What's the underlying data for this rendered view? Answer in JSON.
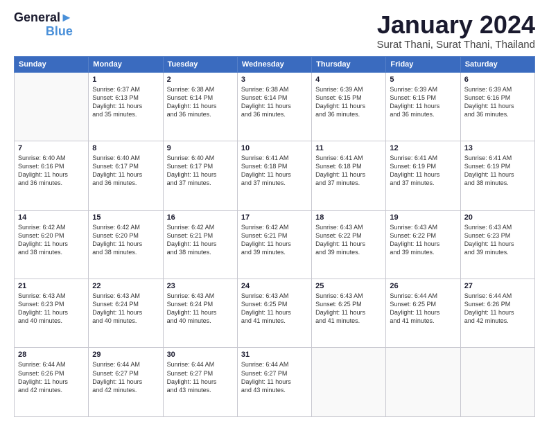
{
  "logo": {
    "line1": "General",
    "line2": "Blue"
  },
  "title": "January 2024",
  "subtitle": "Surat Thani, Surat Thani, Thailand",
  "header_days": [
    "Sunday",
    "Monday",
    "Tuesday",
    "Wednesday",
    "Thursday",
    "Friday",
    "Saturday"
  ],
  "weeks": [
    [
      {
        "day": "",
        "sunrise": "",
        "sunset": "",
        "daylight": ""
      },
      {
        "day": "1",
        "sunrise": "Sunrise: 6:37 AM",
        "sunset": "Sunset: 6:13 PM",
        "daylight": "Daylight: 11 hours and 35 minutes."
      },
      {
        "day": "2",
        "sunrise": "Sunrise: 6:38 AM",
        "sunset": "Sunset: 6:14 PM",
        "daylight": "Daylight: 11 hours and 36 minutes."
      },
      {
        "day": "3",
        "sunrise": "Sunrise: 6:38 AM",
        "sunset": "Sunset: 6:14 PM",
        "daylight": "Daylight: 11 hours and 36 minutes."
      },
      {
        "day": "4",
        "sunrise": "Sunrise: 6:39 AM",
        "sunset": "Sunset: 6:15 PM",
        "daylight": "Daylight: 11 hours and 36 minutes."
      },
      {
        "day": "5",
        "sunrise": "Sunrise: 6:39 AM",
        "sunset": "Sunset: 6:15 PM",
        "daylight": "Daylight: 11 hours and 36 minutes."
      },
      {
        "day": "6",
        "sunrise": "Sunrise: 6:39 AM",
        "sunset": "Sunset: 6:16 PM",
        "daylight": "Daylight: 11 hours and 36 minutes."
      }
    ],
    [
      {
        "day": "7",
        "sunrise": "Sunrise: 6:40 AM",
        "sunset": "Sunset: 6:16 PM",
        "daylight": "Daylight: 11 hours and 36 minutes."
      },
      {
        "day": "8",
        "sunrise": "Sunrise: 6:40 AM",
        "sunset": "Sunset: 6:17 PM",
        "daylight": "Daylight: 11 hours and 36 minutes."
      },
      {
        "day": "9",
        "sunrise": "Sunrise: 6:40 AM",
        "sunset": "Sunset: 6:17 PM",
        "daylight": "Daylight: 11 hours and 37 minutes."
      },
      {
        "day": "10",
        "sunrise": "Sunrise: 6:41 AM",
        "sunset": "Sunset: 6:18 PM",
        "daylight": "Daylight: 11 hours and 37 minutes."
      },
      {
        "day": "11",
        "sunrise": "Sunrise: 6:41 AM",
        "sunset": "Sunset: 6:18 PM",
        "daylight": "Daylight: 11 hours and 37 minutes."
      },
      {
        "day": "12",
        "sunrise": "Sunrise: 6:41 AM",
        "sunset": "Sunset: 6:19 PM",
        "daylight": "Daylight: 11 hours and 37 minutes."
      },
      {
        "day": "13",
        "sunrise": "Sunrise: 6:41 AM",
        "sunset": "Sunset: 6:19 PM",
        "daylight": "Daylight: 11 hours and 38 minutes."
      }
    ],
    [
      {
        "day": "14",
        "sunrise": "Sunrise: 6:42 AM",
        "sunset": "Sunset: 6:20 PM",
        "daylight": "Daylight: 11 hours and 38 minutes."
      },
      {
        "day": "15",
        "sunrise": "Sunrise: 6:42 AM",
        "sunset": "Sunset: 6:20 PM",
        "daylight": "Daylight: 11 hours and 38 minutes."
      },
      {
        "day": "16",
        "sunrise": "Sunrise: 6:42 AM",
        "sunset": "Sunset: 6:21 PM",
        "daylight": "Daylight: 11 hours and 38 minutes."
      },
      {
        "day": "17",
        "sunrise": "Sunrise: 6:42 AM",
        "sunset": "Sunset: 6:21 PM",
        "daylight": "Daylight: 11 hours and 39 minutes."
      },
      {
        "day": "18",
        "sunrise": "Sunrise: 6:43 AM",
        "sunset": "Sunset: 6:22 PM",
        "daylight": "Daylight: 11 hours and 39 minutes."
      },
      {
        "day": "19",
        "sunrise": "Sunrise: 6:43 AM",
        "sunset": "Sunset: 6:22 PM",
        "daylight": "Daylight: 11 hours and 39 minutes."
      },
      {
        "day": "20",
        "sunrise": "Sunrise: 6:43 AM",
        "sunset": "Sunset: 6:23 PM",
        "daylight": "Daylight: 11 hours and 39 minutes."
      }
    ],
    [
      {
        "day": "21",
        "sunrise": "Sunrise: 6:43 AM",
        "sunset": "Sunset: 6:23 PM",
        "daylight": "Daylight: 11 hours and 40 minutes."
      },
      {
        "day": "22",
        "sunrise": "Sunrise: 6:43 AM",
        "sunset": "Sunset: 6:24 PM",
        "daylight": "Daylight: 11 hours and 40 minutes."
      },
      {
        "day": "23",
        "sunrise": "Sunrise: 6:43 AM",
        "sunset": "Sunset: 6:24 PM",
        "daylight": "Daylight: 11 hours and 40 minutes."
      },
      {
        "day": "24",
        "sunrise": "Sunrise: 6:43 AM",
        "sunset": "Sunset: 6:25 PM",
        "daylight": "Daylight: 11 hours and 41 minutes."
      },
      {
        "day": "25",
        "sunrise": "Sunrise: 6:43 AM",
        "sunset": "Sunset: 6:25 PM",
        "daylight": "Daylight: 11 hours and 41 minutes."
      },
      {
        "day": "26",
        "sunrise": "Sunrise: 6:44 AM",
        "sunset": "Sunset: 6:25 PM",
        "daylight": "Daylight: 11 hours and 41 minutes."
      },
      {
        "day": "27",
        "sunrise": "Sunrise: 6:44 AM",
        "sunset": "Sunset: 6:26 PM",
        "daylight": "Daylight: 11 hours and 42 minutes."
      }
    ],
    [
      {
        "day": "28",
        "sunrise": "Sunrise: 6:44 AM",
        "sunset": "Sunset: 6:26 PM",
        "daylight": "Daylight: 11 hours and 42 minutes."
      },
      {
        "day": "29",
        "sunrise": "Sunrise: 6:44 AM",
        "sunset": "Sunset: 6:27 PM",
        "daylight": "Daylight: 11 hours and 42 minutes."
      },
      {
        "day": "30",
        "sunrise": "Sunrise: 6:44 AM",
        "sunset": "Sunset: 6:27 PM",
        "daylight": "Daylight: 11 hours and 43 minutes."
      },
      {
        "day": "31",
        "sunrise": "Sunrise: 6:44 AM",
        "sunset": "Sunset: 6:27 PM",
        "daylight": "Daylight: 11 hours and 43 minutes."
      },
      {
        "day": "",
        "sunrise": "",
        "sunset": "",
        "daylight": ""
      },
      {
        "day": "",
        "sunrise": "",
        "sunset": "",
        "daylight": ""
      },
      {
        "day": "",
        "sunrise": "",
        "sunset": "",
        "daylight": ""
      }
    ]
  ]
}
